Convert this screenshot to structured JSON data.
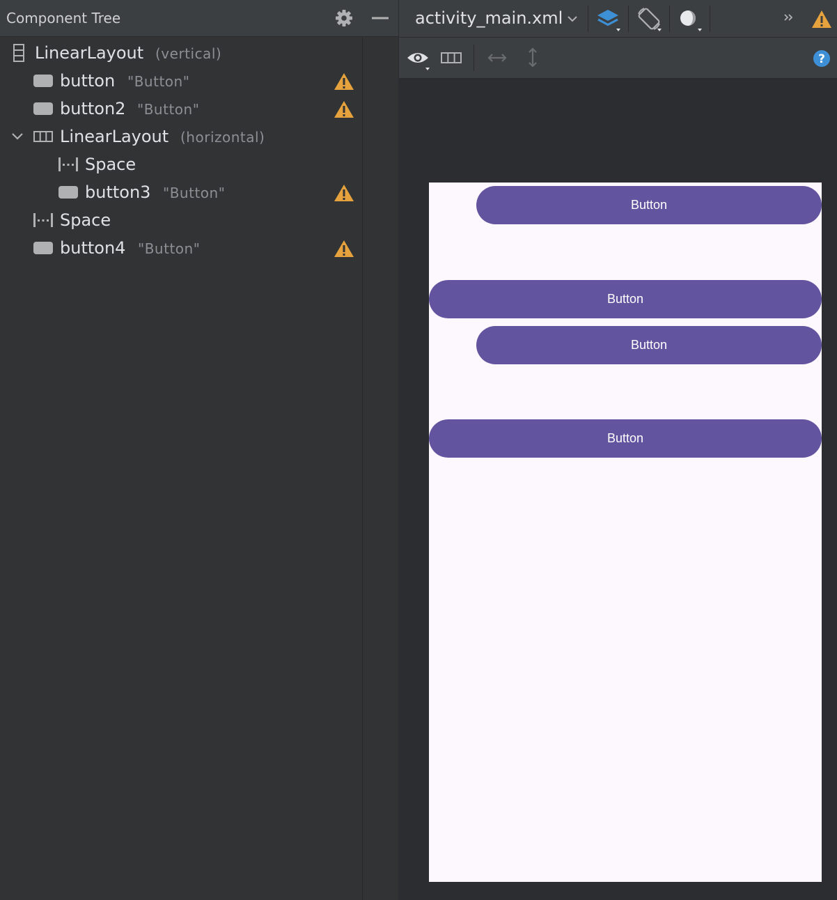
{
  "component_tree": {
    "title": "Component Tree",
    "nodes": [
      {
        "name": "LinearLayout",
        "detail": "(vertical)",
        "icon": "vertical-layout-icon",
        "warning": false
      },
      {
        "name": "button",
        "detail": "\"Button\"",
        "icon": "button-icon",
        "warning": true
      },
      {
        "name": "button2",
        "detail": "\"Button\"",
        "icon": "button-icon",
        "warning": true
      },
      {
        "name": "LinearLayout",
        "detail": "(horizontal)",
        "icon": "horizontal-layout-icon",
        "warning": false,
        "expanded": true
      },
      {
        "name": "Space",
        "detail": "",
        "icon": "space-icon",
        "warning": false
      },
      {
        "name": "button3",
        "detail": "\"Button\"",
        "icon": "button-icon",
        "warning": true
      },
      {
        "name": "Space",
        "detail": "",
        "icon": "space-icon",
        "warning": false
      },
      {
        "name": "button4",
        "detail": "\"Button\"",
        "icon": "button-icon",
        "warning": true
      }
    ]
  },
  "editor": {
    "file_tab": "activity_main.xml",
    "toolbar_icons": [
      "layers-icon",
      "orientation-icon",
      "theme-night-icon",
      "overflow-icon",
      "warning-icon"
    ],
    "design_toolbar_icons": [
      "eye-icon",
      "blueprint-icon",
      "horizontal-resize-icon",
      "vertical-resize-icon",
      "help-icon"
    ]
  },
  "preview": {
    "buttons": [
      {
        "label": "Button"
      },
      {
        "label": "Button"
      },
      {
        "label": "Button"
      },
      {
        "label": "Button"
      }
    ],
    "colors": {
      "button": "#6354a0",
      "surface": "#fdf8fd"
    }
  },
  "colors": {
    "warning": "#e6a23c",
    "accent_blue": "#3d8fd6"
  }
}
